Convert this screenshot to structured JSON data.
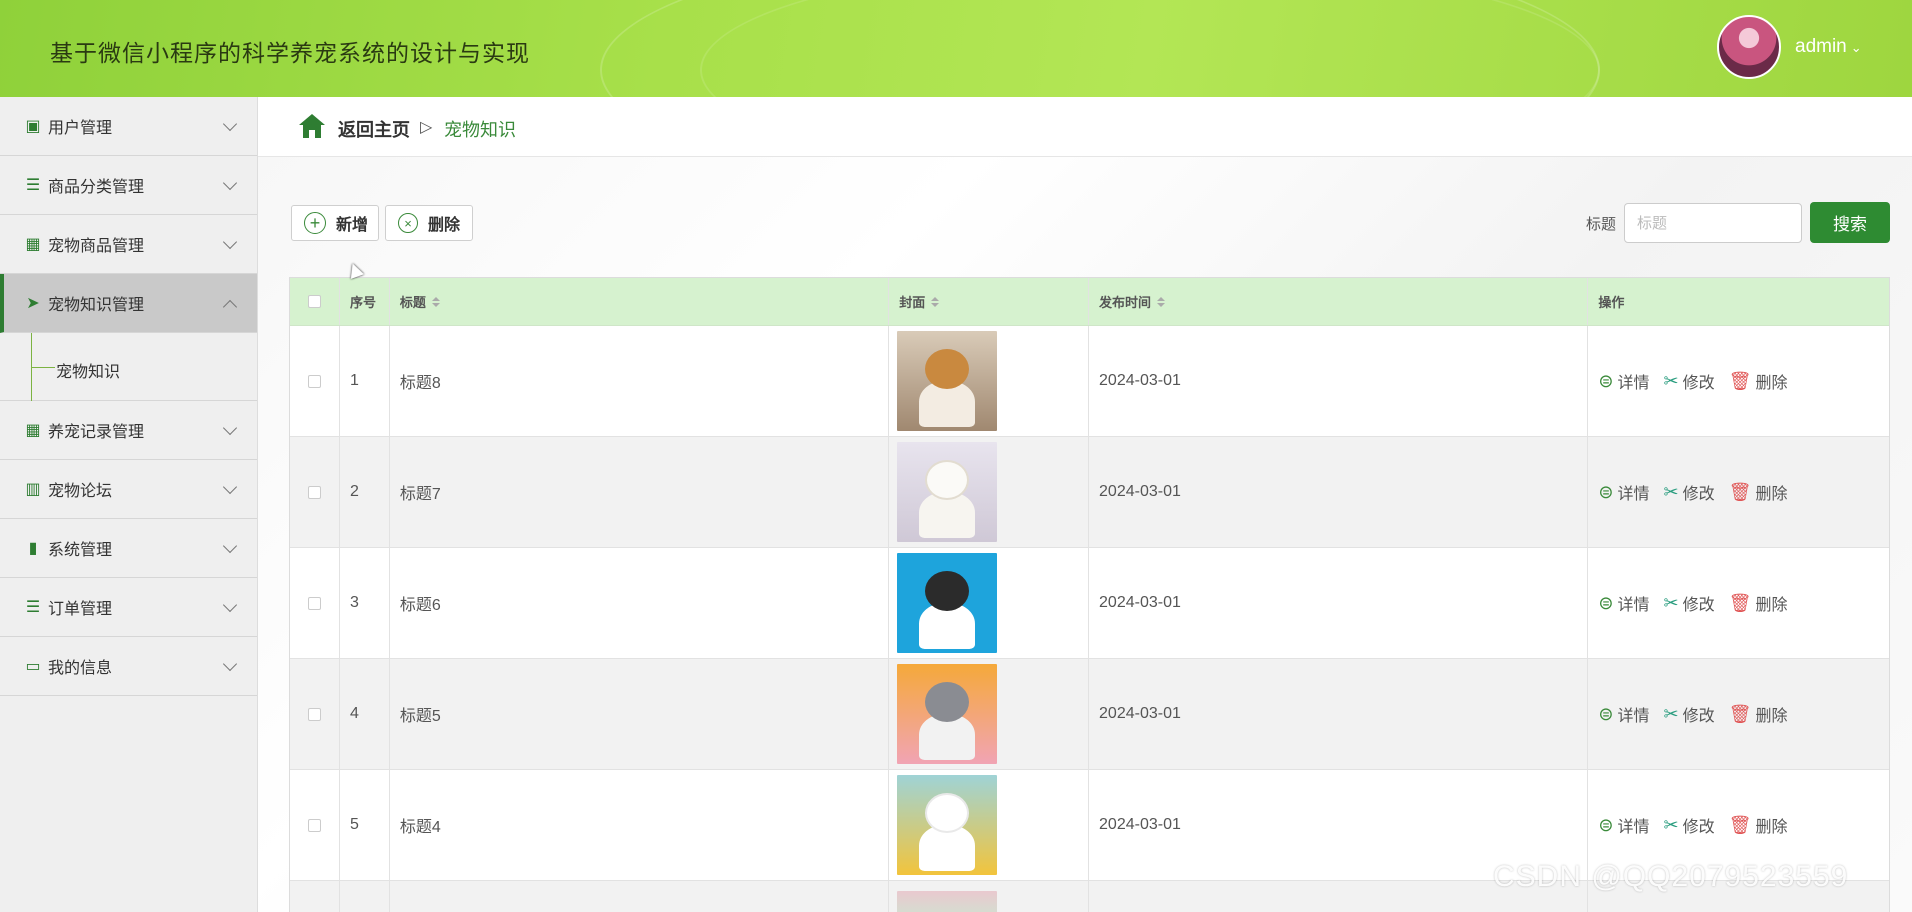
{
  "header": {
    "title": "基于微信小程序的科学养宠系统的设计与实现",
    "username": "admin",
    "caret": "⌄"
  },
  "sidebar": {
    "items": [
      {
        "label": "用户管理",
        "icon": "clipboard-icon",
        "glyph": "▣"
      },
      {
        "label": "商品分类管理",
        "icon": "list-icon",
        "glyph": "☰"
      },
      {
        "label": "宠物商品管理",
        "icon": "grid-icon",
        "glyph": "▦"
      },
      {
        "label": "宠物知识管理",
        "icon": "send-icon",
        "glyph": "➤",
        "active": true
      },
      {
        "label": "养宠记录管理",
        "icon": "grid-icon",
        "glyph": "▦"
      },
      {
        "label": "宠物论坛",
        "icon": "book-icon",
        "glyph": "▥"
      },
      {
        "label": "系统管理",
        "icon": "bar-chart-icon",
        "glyph": "▮"
      },
      {
        "label": "订单管理",
        "icon": "list-icon",
        "glyph": "☰"
      },
      {
        "label": "我的信息",
        "icon": "wallet-icon",
        "glyph": "▭"
      }
    ],
    "submenu_label": "宠物知识"
  },
  "breadcrumb": {
    "home": "返回主页",
    "separator": "▷",
    "current": "宠物知识"
  },
  "toolbar": {
    "add_label": "新增",
    "add_glyph": "+",
    "delete_label": "删除",
    "delete_glyph": "×",
    "search_label": "标题",
    "search_placeholder": "标题",
    "search_button": "搜索"
  },
  "table": {
    "headers": [
      "序号",
      "标题",
      "封面",
      "发布时间",
      "操作"
    ],
    "rows": [
      {
        "index": "1",
        "title": "标题8",
        "date": "2024-03-01"
      },
      {
        "index": "2",
        "title": "标题7",
        "date": "2024-03-01"
      },
      {
        "index": "3",
        "title": "标题6",
        "date": "2024-03-01"
      },
      {
        "index": "4",
        "title": "标题5",
        "date": "2024-03-01"
      },
      {
        "index": "5",
        "title": "标题4",
        "date": "2024-03-01"
      }
    ],
    "actions": {
      "detail": "详情",
      "edit": "修改",
      "delete": "删除"
    }
  },
  "watermark": "CSDN @QQ2079523559",
  "colors": {
    "accent": "#2e8b32",
    "header": "#a8e04a",
    "table_head": "#d6f2cf",
    "delete": "#e05656"
  }
}
